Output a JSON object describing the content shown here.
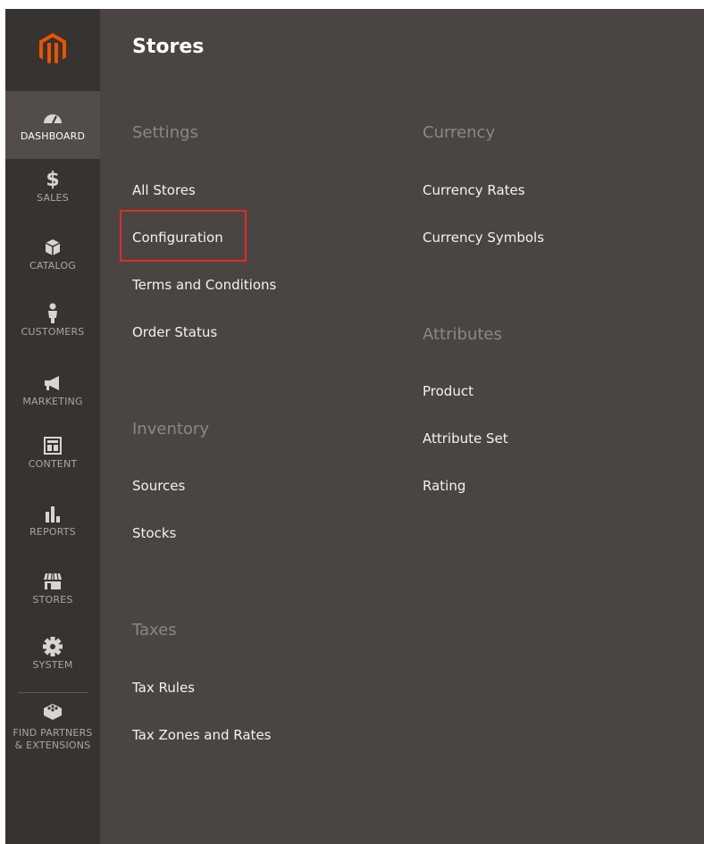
{
  "sidebar": {
    "items": [
      {
        "label": "DASHBOARD",
        "icon": "gauge-icon"
      },
      {
        "label": "SALES",
        "icon": "dollar-icon"
      },
      {
        "label": "CATALOG",
        "icon": "box-icon"
      },
      {
        "label": "CUSTOMERS",
        "icon": "person-icon"
      },
      {
        "label": "MARKETING",
        "icon": "megaphone-icon"
      },
      {
        "label": "CONTENT",
        "icon": "layout-icon"
      },
      {
        "label": "REPORTS",
        "icon": "bar-chart-icon"
      },
      {
        "label": "STORES",
        "icon": "storefront-icon"
      },
      {
        "label": "SYSTEM",
        "icon": "gear-icon"
      },
      {
        "label_line1": "FIND PARTNERS",
        "label_line2": "& EXTENSIONS",
        "icon": "blocks-icon"
      }
    ],
    "active": "DASHBOARD"
  },
  "panel": {
    "title": "Stores",
    "settings": {
      "heading": "Settings",
      "links": [
        "All Stores",
        "Configuration",
        "Terms and Conditions",
        "Order Status"
      ]
    },
    "inventory": {
      "heading": "Inventory",
      "links": [
        "Sources",
        "Stocks"
      ]
    },
    "taxes": {
      "heading": "Taxes",
      "links": [
        "Tax Rules",
        "Tax Zones and Rates"
      ]
    },
    "currency": {
      "heading": "Currency",
      "links": [
        "Currency Rates",
        "Currency Symbols"
      ]
    },
    "attributes": {
      "heading": "Attributes",
      "links": [
        "Product",
        "Attribute Set",
        "Rating"
      ]
    }
  },
  "colors": {
    "sidebar_bg": "#373330",
    "panel_bg": "#4a4542",
    "active_bg": "#524d49",
    "logo_orange": "#eb5202",
    "highlight_red": "#e02b27"
  }
}
